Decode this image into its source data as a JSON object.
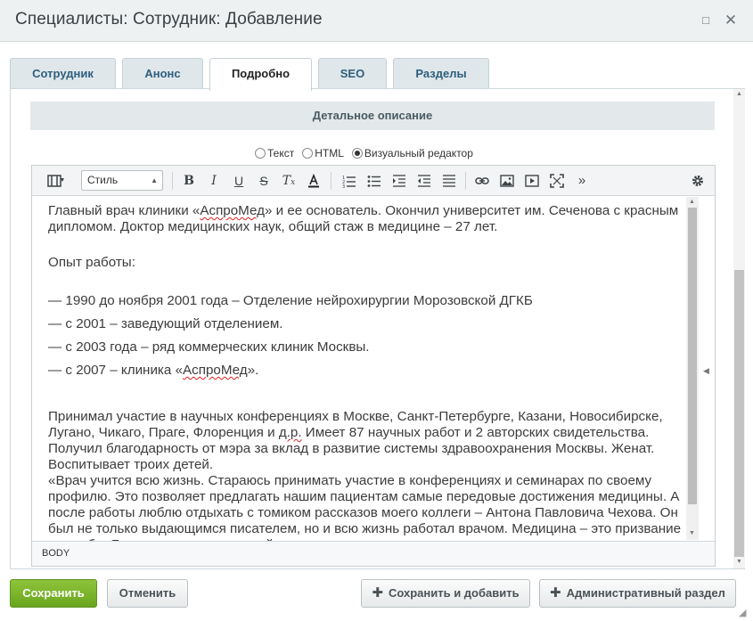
{
  "window": {
    "title": "Специалисты: Сотрудник: Добавление",
    "maximize_icon": "□",
    "close_icon": "✕"
  },
  "tabs": [
    {
      "label": "Сотрудник",
      "active": false
    },
    {
      "label": "Анонс",
      "active": false
    },
    {
      "label": "Подробно",
      "active": true
    },
    {
      "label": "SEO",
      "active": false
    },
    {
      "label": "Разделы",
      "active": false
    }
  ],
  "section": {
    "title": "Детальное описание"
  },
  "editor_modes": {
    "text": "Текст",
    "html": "HTML",
    "visual": "Визуальный редактор",
    "selected": "visual"
  },
  "toolbar": {
    "style_select": "Стиль",
    "icons": [
      "snippets-icon",
      "bold-icon",
      "italic-icon",
      "underline-icon",
      "strikethrough-icon",
      "remove-format-icon",
      "text-color-icon",
      "ordered-list-icon",
      "unordered-list-icon",
      "indent-icon",
      "outdent-icon",
      "align-icon",
      "link-icon",
      "image-icon",
      "video-icon",
      "fullscreen-icon",
      "more-icon",
      "settings-icon"
    ]
  },
  "content": {
    "p1_a": "Главный врач клиники «",
    "p1_b": "АспроМед",
    "p1_c": "» и ее основатель. Окончил университет им. Сеченова с красным дипломом. Доктор медицинских наук, общий стаж в медицине – 27 лет.",
    "experience_heading": "Опыт работы:",
    "items": [
      "— 1990 до ноября 2001 года – Отделение нейрохирургии Морозовской ДГКБ",
      "— с 2001 – заведующий отделением.",
      "— с 2003 года – ряд коммерческих клиник Москвы."
    ],
    "item4_a": "— с 2007 – клиника «",
    "item4_b": "АспроМед",
    "item4_c": "».",
    "p2_a": "Принимал участие в научных конференциях в Москве, Санкт-Петербурге, Казани, Новосибирске, Лугано, Чикаго, Праге, Флоренция и ",
    "p2_b": "д.р.",
    "p2_c": " Имеет 87 научных работ и 2 авторских свидетельства. Получил благодарность от мэра за вклад в развитие системы здравоохранения Москвы. Женат. Воспитывает троих детей.",
    "p3": "«Врач учится всю жизнь. Стараюсь принимать участие в конференциях и семинарах по своему профилю. Это позволяет предлагать нашим пациентам самые передовые достижения медицины. А после работы люблю отдыхать с томиком рассказов моего коллеги – Антона Павловича Чехова. Он был не только выдающимся писателем, но и всю жизнь работал врачом. Медицина – это призвание и судьба. Я очень рад, что дети пойдут по моим стопам и"
  },
  "statusbar": {
    "path": "BODY"
  },
  "footer": {
    "save": "Сохранить",
    "cancel": "Отменить",
    "save_add": "Сохранить и добавить",
    "admin": "Административный раздел"
  }
}
